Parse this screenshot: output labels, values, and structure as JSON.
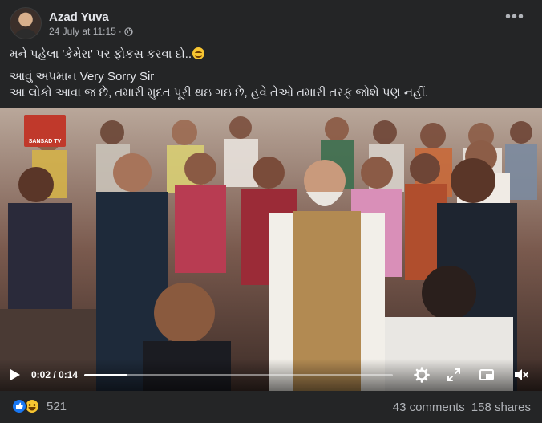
{
  "post": {
    "author": "Azad Yuva",
    "timestamp": "24 July at 11:15",
    "separator": "·",
    "privacy_icon": "globe-icon",
    "more_icon": "more-options-icon",
    "more_label": "•••"
  },
  "caption": {
    "line1": "મને પહેલા 'કેમેરા' પર ફોકસ કરવા દો..",
    "line1_emoji": "smiling-face-emoji",
    "line2": "આવું અપમાન Very Sorry Sir",
    "line3": "આ લોકો આવા જ છે, તમારી મુદત પૂરી થઇ ગઇ છે, હવે તેઓ તમારી તરફ જોશે પણ નહીં."
  },
  "video": {
    "watermark": "SANSAD TV",
    "current_time": "0:02",
    "time_separator": " / ",
    "duration": "0:14",
    "progress": 0.14,
    "controls": [
      "play-icon",
      "settings-icon",
      "fullscreen-icon",
      "miniplayer-icon",
      "mute-icon"
    ]
  },
  "footer": {
    "reaction_icons": [
      "like-icon",
      "haha-icon"
    ],
    "reaction_count": "521",
    "comments": "43 comments",
    "shares": "158 shares"
  },
  "colors": {
    "background": "#242526",
    "primary_text": "#e4e6eb",
    "secondary_text": "#b0b3b8",
    "like_blue": "#1877f2",
    "haha_yellow": "#f7c531"
  }
}
